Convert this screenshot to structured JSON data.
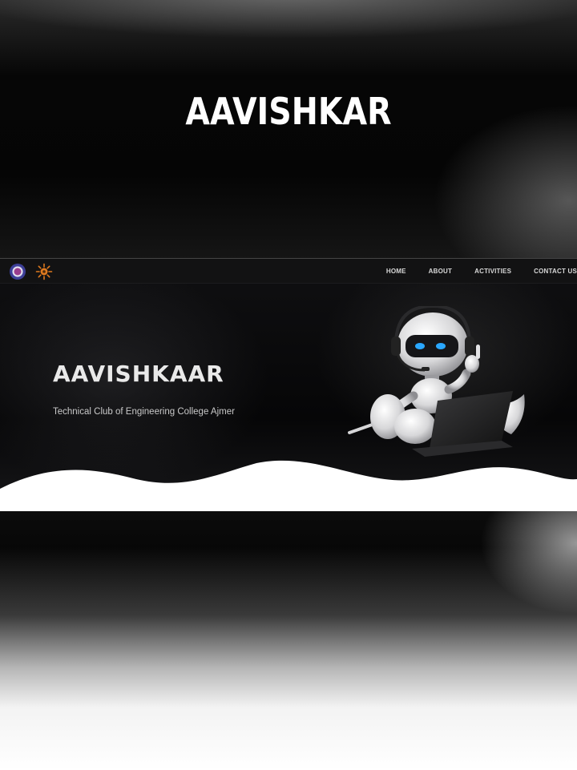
{
  "poster": {
    "title": "AAVISHKAR"
  },
  "website": {
    "nav": {
      "items": [
        {
          "label": "HOME"
        },
        {
          "label": "ABOUT"
        },
        {
          "label": "ACTIVITIES"
        },
        {
          "label": "CONTACT US"
        }
      ]
    },
    "hero": {
      "title": "AAVISHKAAR",
      "subtitle": "Technical Club of Engineering College Ajmer"
    },
    "icons": {
      "college_logo": "college-emblem-icon",
      "club_logo": "sun-gear-logo-icon",
      "hero_image": "robot-with-laptop-illustration"
    },
    "colors": {
      "background": "#0b0b0c",
      "nav_text": "#d8d8d8",
      "hero_text": "#e9e9e9",
      "wave": "#ffffff",
      "club_logo": "#e07a1f",
      "robot_eyes": "#2aa7ff"
    }
  }
}
